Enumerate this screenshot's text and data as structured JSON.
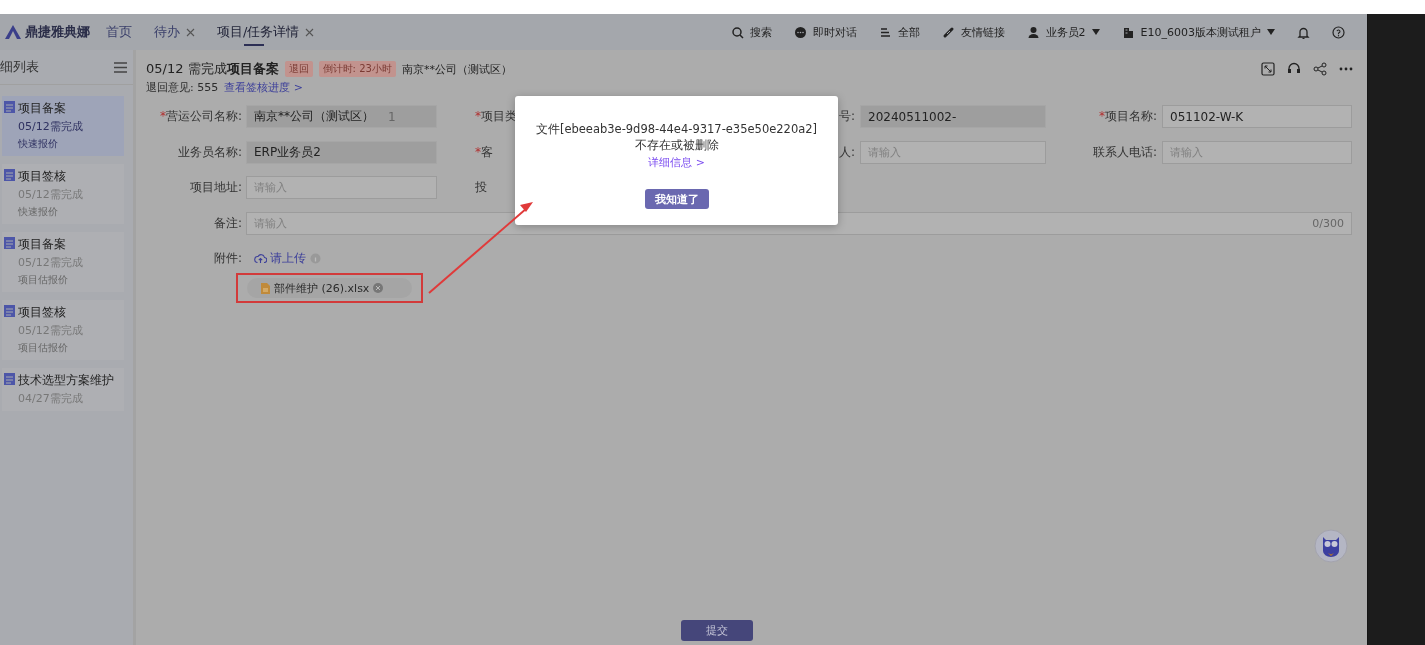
{
  "header": {
    "logo": "鼎捷雅典娜",
    "tabs": [
      {
        "label": "首页",
        "closable": false,
        "selected": false
      },
      {
        "label": "待办",
        "closable": true,
        "selected": false
      },
      {
        "label": "项目/任务详情",
        "closable": true,
        "selected": true
      }
    ],
    "tools": [
      {
        "kind": "search",
        "label": "搜索"
      },
      {
        "kind": "chat",
        "label": "即时对话"
      },
      {
        "kind": "list",
        "label": "全部"
      },
      {
        "kind": "link",
        "label": "友情链接"
      },
      {
        "kind": "user",
        "label": "业务员2",
        "dropdown": true
      },
      {
        "kind": "tenant",
        "label": "E10_6003版本测试租户",
        "dropdown": true
      },
      {
        "kind": "bell"
      },
      {
        "kind": "help"
      }
    ]
  },
  "sidebar": {
    "title": "细列表",
    "items": [
      {
        "title": "项目备案",
        "date": "05/12需完成",
        "sub": "快速报价",
        "selected": true
      },
      {
        "title": "项目签核",
        "date": "05/12需完成",
        "sub": "快速报价",
        "selected": false
      },
      {
        "title": "项目备案",
        "date": "05/12需完成",
        "sub": "项目估报价",
        "selected": false
      },
      {
        "title": "项目签核",
        "date": "05/12需完成",
        "sub": "项目估报价",
        "selected": false
      },
      {
        "title": "技术选型方案维护",
        "date": "04/27需完成",
        "selected": false
      }
    ]
  },
  "task": {
    "title": "05/12 需完成**项目备案**",
    "badges": [
      "退回",
      "倒计时: 23小时"
    ],
    "company": "南京**公司（测试区）",
    "comment": "退回意见: 555",
    "progress_link": "查看签核进度 >"
  },
  "form": {
    "rows": [
      [
        {
          "mark": "*",
          "label": "营运公司名称:",
          "value": "南京**公司（测试区）",
          "suffix": "1",
          "disabled": true
        },
        {
          "mark": "*",
          "label": "项目类"
        },
        {
          "label": "号:",
          "value": "20240511002-",
          "disabled": true
        },
        {
          "mark": "*",
          "label": "项目名称:",
          "value": "051102-W-K",
          "disabled": false
        }
      ],
      [
        {
          "label": "业务员名称:",
          "value": "ERP业务员2",
          "disabled": true
        },
        {
          "mark": "*",
          "label": "客"
        },
        {
          "label": "人:",
          "placeholder": "请输入",
          "disabled": false
        },
        {
          "label": "联系人电话:",
          "placeholder": "请输入",
          "disabled": false
        }
      ],
      [
        {
          "label": "项目地址:",
          "placeholder": "请输入",
          "disabled": false
        },
        {
          "label": "投"
        }
      ]
    ],
    "remarks": {
      "label": "备注:",
      "placeholder": "请输入",
      "counter": "0/300"
    },
    "attachment": {
      "label": "附件:",
      "upload": "请上传",
      "file": "部件维护 (26).xlsx"
    },
    "submit": "提交"
  },
  "dialog": {
    "message": "文件[ebeeab3e-9d98-44e4-9317-e35e50e220a2]不存在或被删除",
    "details": "详细信息 >",
    "button": "我知道了"
  }
}
